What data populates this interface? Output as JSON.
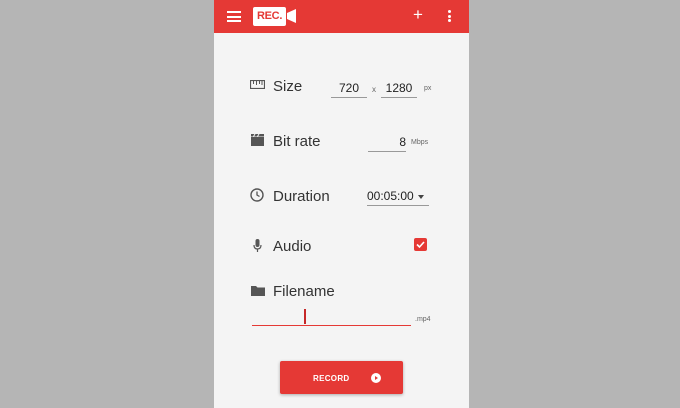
{
  "colors": {
    "accent": "#e53935",
    "background": "#b5b5b5",
    "panel": "#f4f4f4"
  },
  "appbar": {
    "logo_text": "REC.",
    "menu_icon": "hamburger-menu-icon",
    "add_icon": "plus-icon",
    "more_icon": "more-vert-icon",
    "plus_glyph": "+"
  },
  "size": {
    "label": "Size",
    "width": "720",
    "separator": "x",
    "height": "1280",
    "unit": "px",
    "icon": "ruler-icon"
  },
  "bitrate": {
    "label": "Bit rate",
    "value": "8",
    "unit": "Mbps",
    "icon": "clapperboard-icon"
  },
  "duration": {
    "label": "Duration",
    "value": "00:05:00",
    "icon": "clock-icon"
  },
  "audio": {
    "label": "Audio",
    "checked": true,
    "icon": "microphone-icon"
  },
  "filename": {
    "label": "Filename",
    "value": "",
    "extension": ".mp4",
    "icon": "folder-icon"
  },
  "record_button": {
    "label": "RECORD",
    "icon": "play-circle-icon"
  }
}
